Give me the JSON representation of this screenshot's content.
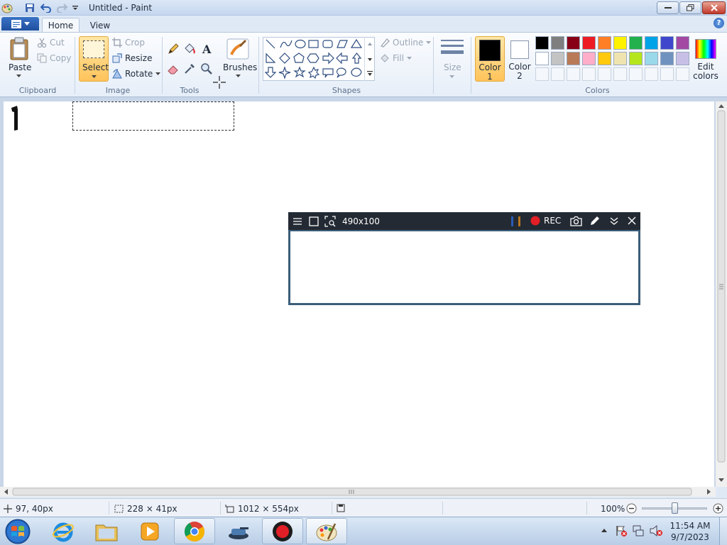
{
  "window": {
    "title": "Untitled - Paint"
  },
  "tabs": [
    {
      "label": "Home"
    },
    {
      "label": "View"
    }
  ],
  "clipboard": {
    "paste": "Paste",
    "cut": "Cut",
    "copy": "Copy",
    "group": "Clipboard"
  },
  "image": {
    "select": "Select",
    "crop": "Crop",
    "resize": "Resize",
    "rotate": "Rotate",
    "group": "Image"
  },
  "tools": {
    "group": "Tools"
  },
  "brushes": {
    "label": "Brushes"
  },
  "shapes": {
    "outline": "Outline",
    "fill": "Fill",
    "group": "Shapes"
  },
  "size": {
    "label": "Size"
  },
  "colors": {
    "color1": "Color",
    "color1_num": "1",
    "color2": "Color",
    "color2_num": "2",
    "edit": "Edit",
    "edit2": "colors",
    "group": "Colors",
    "palette_row1": [
      "#000000",
      "#7f7f7f",
      "#880015",
      "#ed1c24",
      "#ff7f27",
      "#fff200",
      "#22b14c",
      "#00a2e8",
      "#3f48cc",
      "#a349a4"
    ],
    "palette_row2": [
      "#ffffff",
      "#c3c3c3",
      "#b97a57",
      "#ffaec9",
      "#ffc90e",
      "#efe4b0",
      "#b5e61d",
      "#99d9ea",
      "#7092be",
      "#c8bfe7"
    ]
  },
  "recorder": {
    "size": "490x100",
    "rec": "REC"
  },
  "status": {
    "cursor_pos": "97, 40px",
    "selection_size": "228 × 41px",
    "canvas_size": "1012 × 554px",
    "zoom": "100%",
    "zoom_slider": 0.5
  },
  "clock": {
    "time": "11:54 AM",
    "date": "9/7/2023"
  }
}
